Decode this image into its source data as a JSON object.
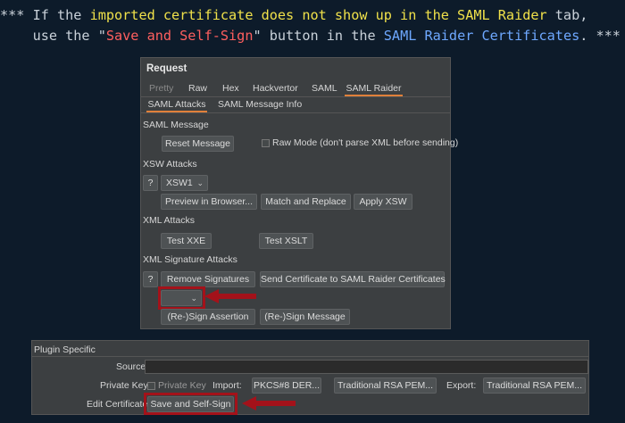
{
  "note": {
    "part1": "*** If the ",
    "part2": "imported certificate does not show up in the SAML Raider",
    "part3": " tab,",
    "part4": "    use the \"",
    "part5": "Save and Self-Sign",
    "part6": "\" button in the ",
    "part7": "SAML Raider Certificates",
    "part8": ". ***"
  },
  "request": {
    "title": "Request",
    "tabs": [
      "Pretty",
      "Raw",
      "Hex",
      "Hackvertor",
      "SAML",
      "SAML Raider"
    ],
    "subtabs": [
      "SAML Attacks",
      "SAML Message Info"
    ],
    "saml_message_label": "SAML Message",
    "reset_message": "Reset Message",
    "raw_mode": "Raw Mode (don't parse XML before sending)",
    "xsw_label": "XSW Attacks",
    "help": "?",
    "xsw_value": "XSW1",
    "preview": "Preview in Browser...",
    "match_replace": "Match and Replace",
    "apply_xsw": "Apply XSW",
    "xml_attacks_label": "XML Attacks",
    "test_xxe": "Test XXE",
    "test_xslt": "Test XSLT",
    "xml_sig_label": "XML Signature Attacks",
    "remove_signatures": "Remove Signatures",
    "send_cert": "Send Certificate to SAML Raider Certificates",
    "cert_value": "",
    "resign_assertion": "(Re-)Sign Assertion",
    "resign_message": "(Re-)Sign Message"
  },
  "plugin": {
    "title": "Plugin Specific",
    "source_label": "Source",
    "source_value": "",
    "private_key_label": "Private Key",
    "private_key_check": "Private Key",
    "import_label": "Import:",
    "pkcs8": "PKCS#8 DER...",
    "trad_rsa_import": "Traditional RSA PEM...",
    "export_label": "Export:",
    "trad_rsa_export": "Traditional RSA PEM...",
    "edit_cert_label": "Edit Certificate",
    "save_self_sign": "Save and Self-Sign"
  },
  "colors": {
    "highlight": "#a3121a",
    "accent_tab": "#e0803a",
    "note_yellow": "#f0e14a",
    "note_red": "#ff5f5f",
    "note_blue": "#6ea8ff"
  }
}
